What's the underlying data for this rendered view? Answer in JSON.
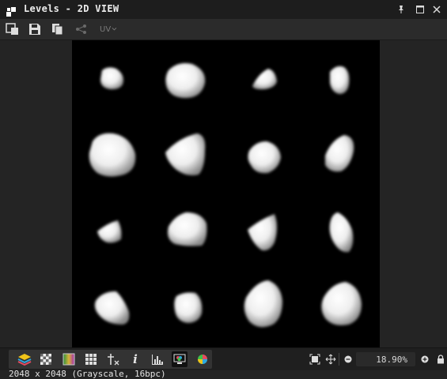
{
  "window": {
    "title": "Levels - 2D VIEW"
  },
  "toolbar": {
    "uv_label": "UV"
  },
  "viewport": {
    "info": "2048 x 2048 (Grayscale, 16bpc)"
  },
  "bottom": {
    "zoom": "18.90%"
  }
}
